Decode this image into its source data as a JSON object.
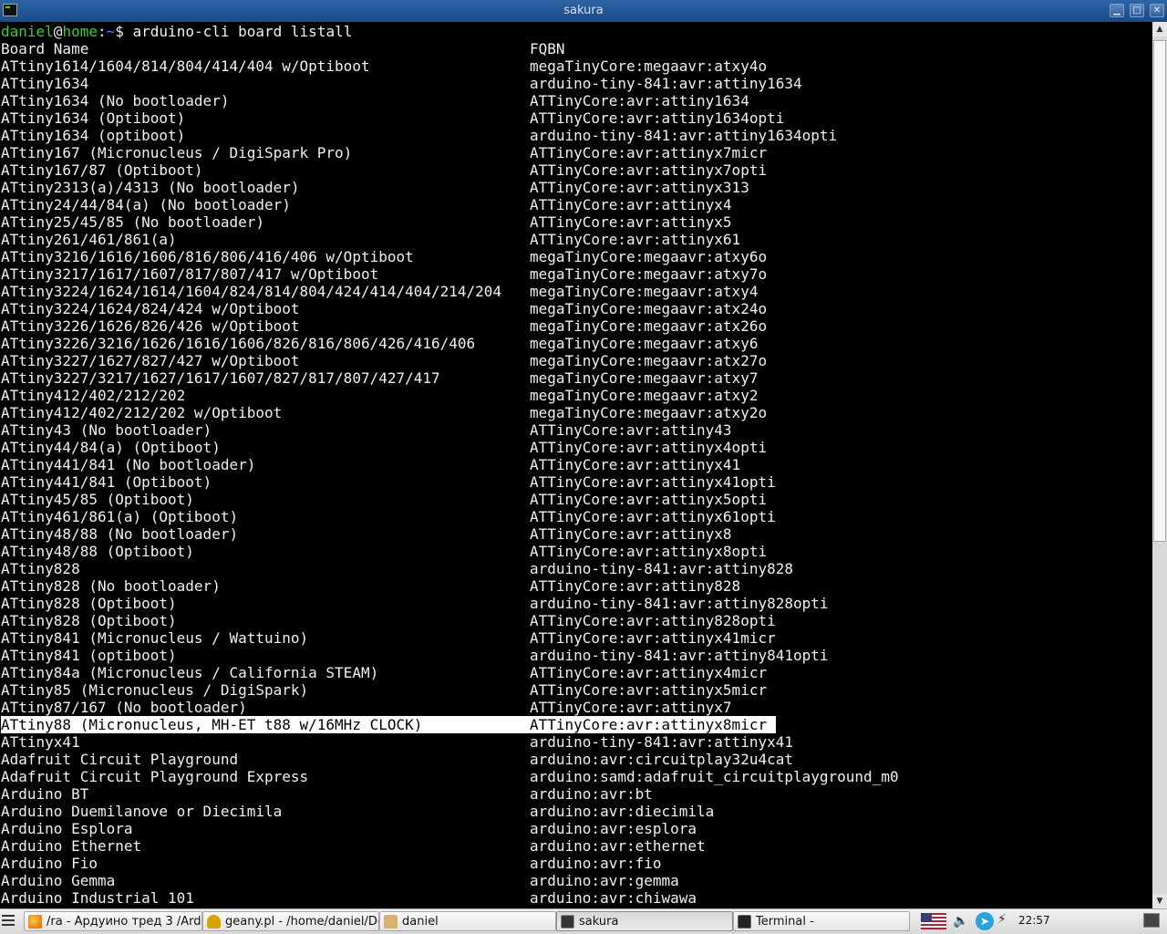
{
  "window": {
    "title": "sakura",
    "minimize": "▁",
    "maximize": "□",
    "close": "✕"
  },
  "terminal": {
    "prompt": {
      "user": "daniel",
      "at": "@",
      "host": "home",
      "sep": ":",
      "dir": "~",
      "dollar": "$",
      "command": " arduino-cli board listall"
    },
    "header": {
      "name": "Board Name",
      "fqbn": "FQBN"
    },
    "rows": [
      {
        "name": "ATtiny1614/1604/814/804/414/404 w/Optiboot",
        "fqbn": "megaTinyCore:megaavr:atxy4o"
      },
      {
        "name": "ATtiny1634",
        "fqbn": "arduino-tiny-841:avr:attiny1634"
      },
      {
        "name": "ATtiny1634 (No bootloader)",
        "fqbn": "ATTinyCore:avr:attiny1634"
      },
      {
        "name": "ATtiny1634 (Optiboot)",
        "fqbn": "ATTinyCore:avr:attiny1634opti"
      },
      {
        "name": "ATtiny1634 (optiboot)",
        "fqbn": "arduino-tiny-841:avr:attiny1634opti"
      },
      {
        "name": "ATtiny167 (Micronucleus / DigiSpark Pro)",
        "fqbn": "ATTinyCore:avr:attinyx7micr"
      },
      {
        "name": "ATtiny167/87 (Optiboot)",
        "fqbn": "ATTinyCore:avr:attinyx7opti"
      },
      {
        "name": "ATtiny2313(a)/4313 (No bootloader)",
        "fqbn": "ATTinyCore:avr:attinyx313"
      },
      {
        "name": "ATtiny24/44/84(a) (No bootloader)",
        "fqbn": "ATTinyCore:avr:attinyx4"
      },
      {
        "name": "ATtiny25/45/85 (No bootloader)",
        "fqbn": "ATTinyCore:avr:attinyx5"
      },
      {
        "name": "ATtiny261/461/861(a)",
        "fqbn": "ATTinyCore:avr:attinyx61"
      },
      {
        "name": "ATtiny3216/1616/1606/816/806/416/406 w/Optiboot",
        "fqbn": "megaTinyCore:megaavr:atxy6o"
      },
      {
        "name": "ATtiny3217/1617/1607/817/807/417 w/Optiboot",
        "fqbn": "megaTinyCore:megaavr:atxy7o"
      },
      {
        "name": "ATtiny3224/1624/1614/1604/824/814/804/424/414/404/214/204",
        "fqbn": "megaTinyCore:megaavr:atxy4"
      },
      {
        "name": "ATtiny3224/1624/824/424 w/Optiboot",
        "fqbn": "megaTinyCore:megaavr:atx24o"
      },
      {
        "name": "ATtiny3226/1626/826/426 w/Optiboot",
        "fqbn": "megaTinyCore:megaavr:atx26o"
      },
      {
        "name": "ATtiny3226/3216/1626/1616/1606/826/816/806/426/416/406",
        "fqbn": "megaTinyCore:megaavr:atxy6"
      },
      {
        "name": "ATtiny3227/1627/827/427 w/Optiboot",
        "fqbn": "megaTinyCore:megaavr:atx27o"
      },
      {
        "name": "ATtiny3227/3217/1627/1617/1607/827/817/807/427/417",
        "fqbn": "megaTinyCore:megaavr:atxy7"
      },
      {
        "name": "ATtiny412/402/212/202",
        "fqbn": "megaTinyCore:megaavr:atxy2"
      },
      {
        "name": "ATtiny412/402/212/202 w/Optiboot",
        "fqbn": "megaTinyCore:megaavr:atxy2o"
      },
      {
        "name": "ATtiny43 (No bootloader)",
        "fqbn": "ATTinyCore:avr:attiny43"
      },
      {
        "name": "ATtiny44/84(a) (Optiboot)",
        "fqbn": "ATTinyCore:avr:attinyx4opti"
      },
      {
        "name": "ATtiny441/841 (No bootloader)",
        "fqbn": "ATTinyCore:avr:attinyx41"
      },
      {
        "name": "ATtiny441/841 (Optiboot)",
        "fqbn": "ATTinyCore:avr:attinyx41opti"
      },
      {
        "name": "ATtiny45/85 (Optiboot)",
        "fqbn": "ATTinyCore:avr:attinyx5opti"
      },
      {
        "name": "ATtiny461/861(a) (Optiboot)",
        "fqbn": "ATTinyCore:avr:attinyx61opti"
      },
      {
        "name": "ATtiny48/88 (No bootloader)",
        "fqbn": "ATTinyCore:avr:attinyx8"
      },
      {
        "name": "ATtiny48/88 (Optiboot)",
        "fqbn": "ATTinyCore:avr:attinyx8opti"
      },
      {
        "name": "ATtiny828",
        "fqbn": "arduino-tiny-841:avr:attiny828"
      },
      {
        "name": "ATtiny828 (No bootloader)",
        "fqbn": "ATTinyCore:avr:attiny828"
      },
      {
        "name": "ATtiny828 (Optiboot)",
        "fqbn": "arduino-tiny-841:avr:attiny828opti"
      },
      {
        "name": "ATtiny828 (Optiboot)",
        "fqbn": "ATTinyCore:avr:attiny828opti"
      },
      {
        "name": "ATtiny841 (Micronucleus / Wattuino)",
        "fqbn": "ATTinyCore:avr:attinyx41micr"
      },
      {
        "name": "ATtiny841 (optiboot)",
        "fqbn": "arduino-tiny-841:avr:attiny841opti"
      },
      {
        "name": "ATtiny84a (Micronucleus / California STEAM)",
        "fqbn": "ATTinyCore:avr:attinyx4micr"
      },
      {
        "name": "ATtiny85 (Micronucleus / DigiSpark)",
        "fqbn": "ATTinyCore:avr:attinyx5micr"
      },
      {
        "name": "ATtiny87/167 (No bootloader)",
        "fqbn": "ATTinyCore:avr:attinyx7"
      },
      {
        "name": "ATtiny88 (Micronucleus, MH-ET t88 w/16MHz CLOCK)",
        "fqbn": "ATTinyCore:avr:attinyx8micr",
        "selected": true
      },
      {
        "name": "ATtinyx41",
        "fqbn": "arduino-tiny-841:avr:attinyx41"
      },
      {
        "name": "Adafruit Circuit Playground",
        "fqbn": "arduino:avr:circuitplay32u4cat"
      },
      {
        "name": "Adafruit Circuit Playground Express",
        "fqbn": "arduino:samd:adafruit_circuitplayground_m0"
      },
      {
        "name": "Arduino BT",
        "fqbn": "arduino:avr:bt"
      },
      {
        "name": "Arduino Duemilanove or Diecimila",
        "fqbn": "arduino:avr:diecimila"
      },
      {
        "name": "Arduino Esplora",
        "fqbn": "arduino:avr:esplora"
      },
      {
        "name": "Arduino Ethernet",
        "fqbn": "arduino:avr:ethernet"
      },
      {
        "name": "Arduino Fio",
        "fqbn": "arduino:avr:fio"
      },
      {
        "name": "Arduino Gemma",
        "fqbn": "arduino:avr:gemma"
      },
      {
        "name": "Arduino Industrial 101",
        "fqbn": "arduino:avr:chiwawa"
      }
    ]
  },
  "taskbar": {
    "items": [
      {
        "label": "/ra - Ардуино тред 3 /Ardui...",
        "icon": "firefox-icon",
        "color": "#e66000"
      },
      {
        "label": "geany.pl - /home/daniel/Do...",
        "icon": "geany-icon",
        "color": "#d9a400"
      },
      {
        "label": "daniel",
        "icon": "folder-icon",
        "color": "#d9b36c"
      },
      {
        "label": "sakura",
        "icon": "terminal-icon",
        "color": "#333333",
        "active": true
      },
      {
        "label": "Terminal -",
        "icon": "terminal-icon",
        "color": "#222222"
      }
    ],
    "clock": "22:57",
    "tray": [
      "us-flag-icon",
      "volume-icon",
      "telegram-icon",
      "network-icon",
      "screen-icon"
    ]
  },
  "colors": {
    "accent": "#2e64a6",
    "prompt_user": "#34d234",
    "prompt_dir": "#4a7fff"
  }
}
